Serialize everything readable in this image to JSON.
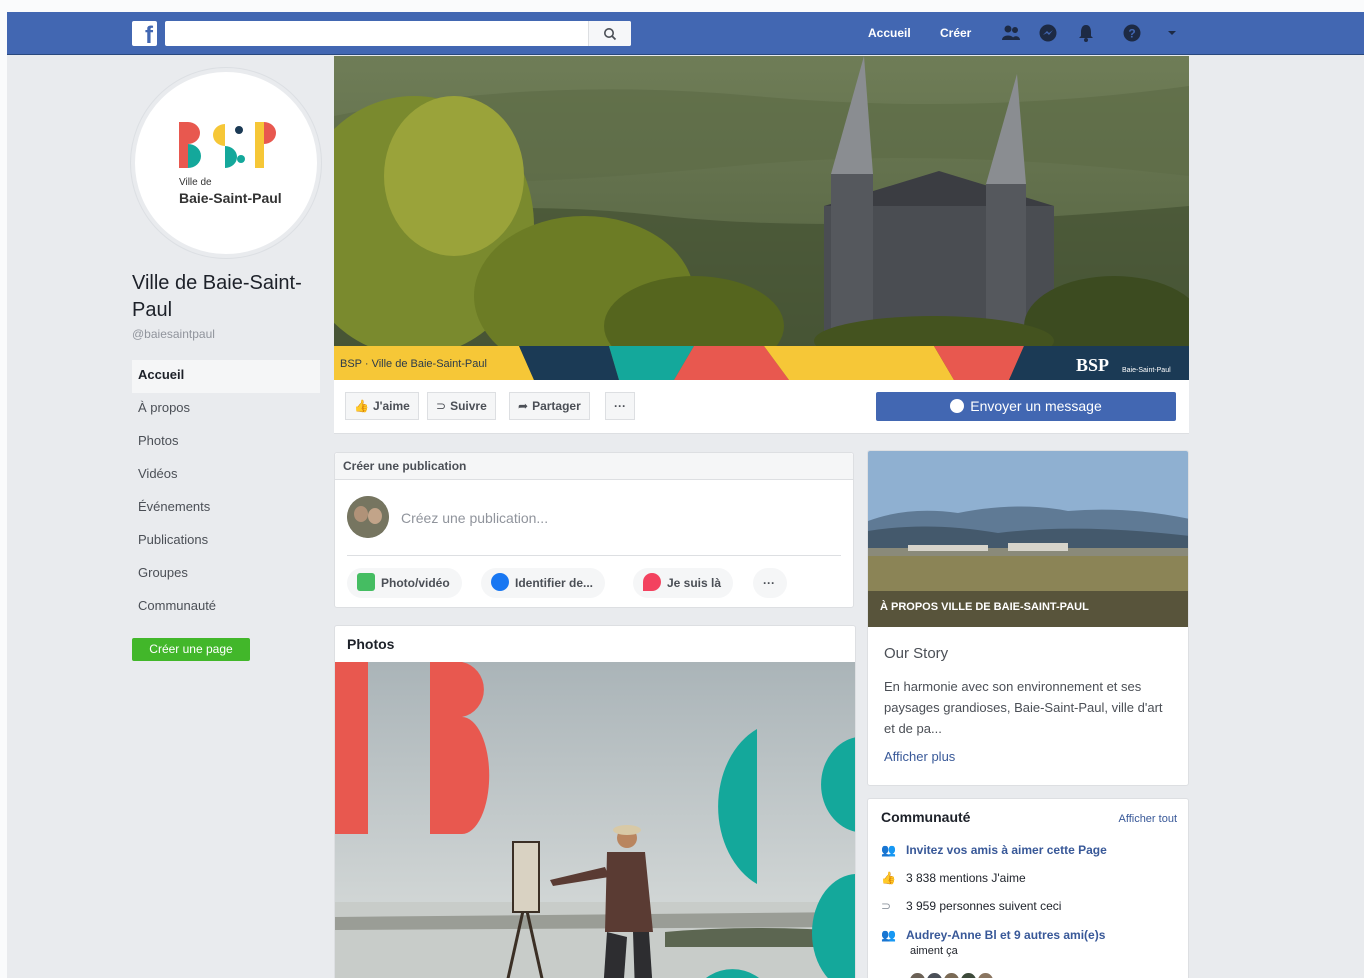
{
  "topbar": {
    "logo": "f",
    "search_placeholder": "",
    "nav_home": "Accueil",
    "nav_create": "Créer"
  },
  "page": {
    "name": "Ville de Baie-Saint-Paul",
    "handle": "@baiesaintpaul",
    "logo_letters": "BSP",
    "logo_small": "Ville de",
    "logo_name": "Baie-Saint-Paul"
  },
  "sidebar": {
    "items": [
      {
        "label": "Accueil"
      },
      {
        "label": "À propos"
      },
      {
        "label": "Photos"
      },
      {
        "label": "Vidéos"
      },
      {
        "label": "Événements"
      },
      {
        "label": "Publications"
      },
      {
        "label": "Groupes"
      },
      {
        "label": "Communauté"
      }
    ],
    "create_page": "Créer une page"
  },
  "cover": {
    "caption": "BSP · Ville de Baie-Saint-Paul"
  },
  "actions": {
    "like": "J'aime",
    "follow": "Suivre",
    "share": "Partager",
    "more": "···",
    "send_message": "Envoyer un message"
  },
  "composer": {
    "title": "Créer une publication",
    "placeholder": "Créez une publication...",
    "photo_video": "Photo/vidéo",
    "tag": "Identifier de...",
    "checkin": "Je suis là",
    "more": "···"
  },
  "photos": {
    "title": "Photos"
  },
  "about": {
    "caption": "À PROPOS VILLE DE BAIE-SAINT-PAUL",
    "story_title": "Our Story",
    "story_text": "En harmonie avec son environnement et ses paysages grandioses, Baie-Saint-Paul, ville d'art et de pa...",
    "show_more": "Afficher plus"
  },
  "community": {
    "title": "Communauté",
    "see_all": "Afficher tout",
    "invite": "Invitez vos amis à aimer cette Page",
    "likes": "3 838 mentions J'aime",
    "follows": "3 959 personnes suivent ceci",
    "friends": "Audrey-Anne Bl et 9 autres ami(e)s",
    "friends_suffix": "aiment ça"
  },
  "colors": {
    "brand_blue": "#4267b2",
    "green": "#42b72a",
    "bsp_red": "#e8584f",
    "bsp_teal": "#14a89b",
    "bsp_yellow": "#f6c737",
    "bsp_navy": "#1b3a55"
  }
}
